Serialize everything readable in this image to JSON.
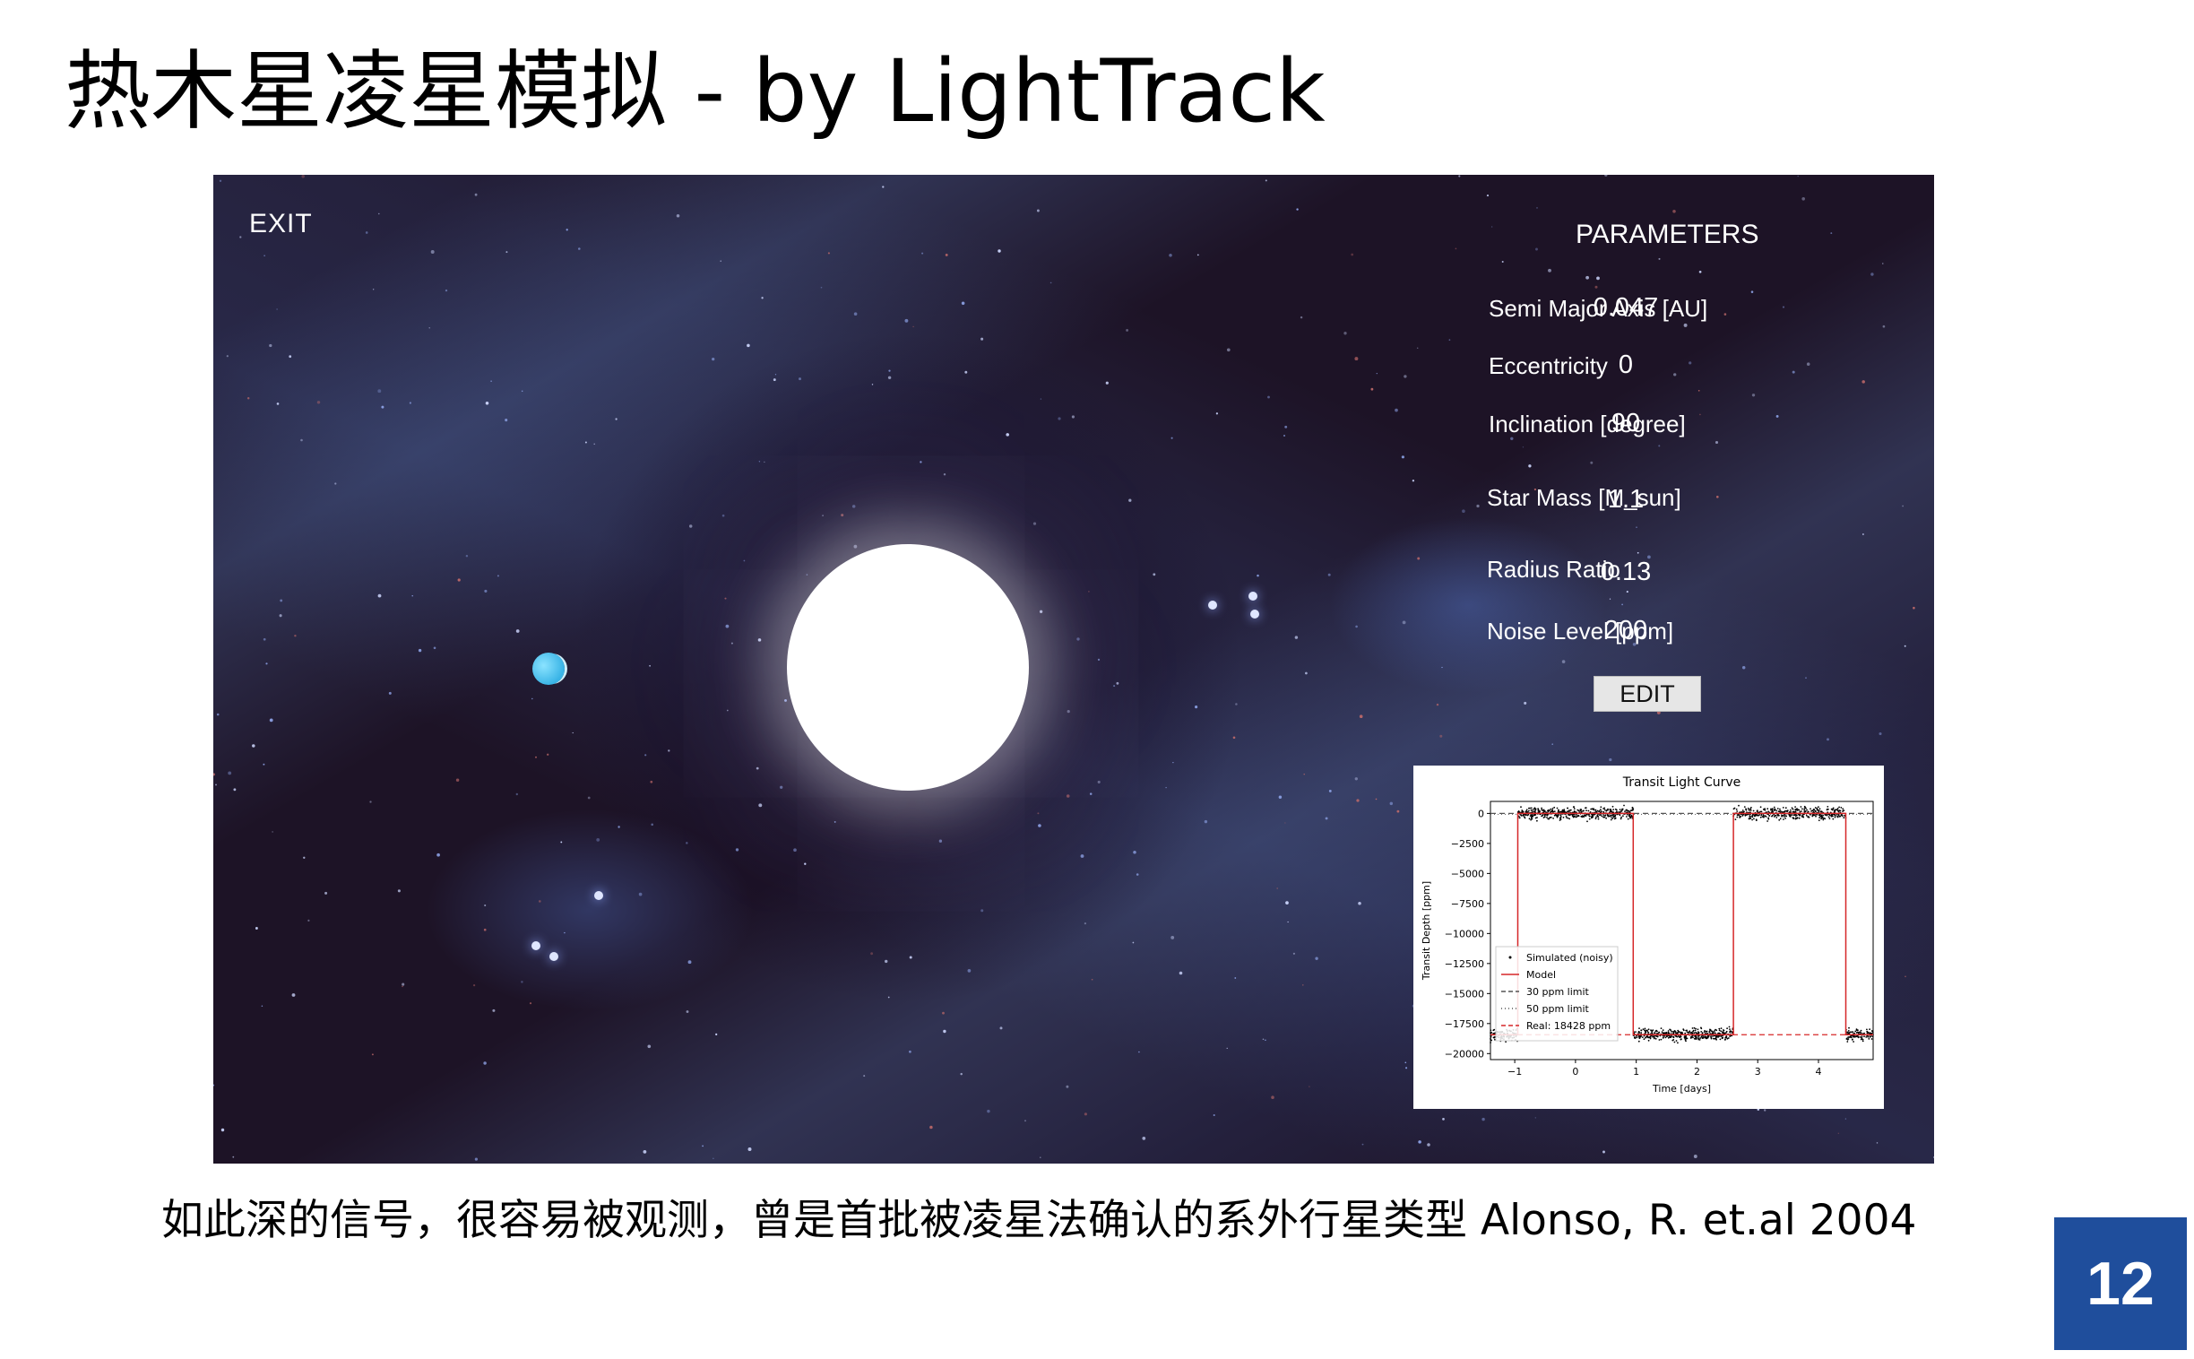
{
  "slide": {
    "title": "热木星凌星模拟 - by LightTrack",
    "caption": "如此深的信号，很容易被观测，曾是首批被凌星法确认的系外行星类型 Alonso, R. et.al 2004",
    "page_number": "12"
  },
  "app": {
    "exit_label": "EXIT",
    "parameters_title": "PARAMETERS",
    "parameters": [
      {
        "label": "Semi Major Axis [AU]",
        "value": "0.047"
      },
      {
        "label": "Eccentricity",
        "value": "0"
      },
      {
        "label": "Inclination [degree]",
        "value": "90"
      },
      {
        "label": "Star Mass [M_sun]",
        "value": "1.1"
      },
      {
        "label": "Radius Ratio",
        "value": "0.13"
      },
      {
        "label": "Noise Level [ppm]",
        "value": "200"
      }
    ],
    "edit_label": "EDIT"
  },
  "chart_data": {
    "type": "line",
    "title": "Transit Light Curve",
    "xlabel": "Time [days]",
    "ylabel": "Transit Depth [ppm]",
    "xlim": [
      -1.4,
      4.9
    ],
    "ylim": [
      -20500,
      1000
    ],
    "x_ticks": [
      -1,
      0,
      1,
      2,
      3,
      4
    ],
    "y_ticks": [
      0,
      -2500,
      -5000,
      -7500,
      -10000,
      -12500,
      -15000,
      -17500,
      -20000
    ],
    "x_tick_labels": [
      "−1",
      "0",
      "1",
      "2",
      "3",
      "4"
    ],
    "y_tick_labels": [
      "0",
      "−2500",
      "−5000",
      "−7500",
      "−10000",
      "−12500",
      "−15000",
      "−17500",
      "−20000"
    ],
    "legend_position": "bottom-left",
    "series": [
      {
        "name": "Simulated (noisy)",
        "style": "points",
        "color": "#000000"
      },
      {
        "name": "Model",
        "style": "line",
        "color": "#d62728",
        "x": [
          -1.4,
          -0.95,
          -0.95,
          -0.95,
          0.95,
          0.95,
          2.6,
          2.6,
          4.45,
          4.45,
          4.9
        ],
        "y": [
          -18428,
          -18428,
          0,
          0,
          0,
          -18428,
          -18428,
          0,
          0,
          -18428,
          -18428
        ]
      },
      {
        "name": "30 ppm limit",
        "style": "dashed",
        "color": "#555555",
        "y": 0
      },
      {
        "name": "50 ppm limit",
        "style": "dotted",
        "color": "#555555",
        "y": 0
      },
      {
        "name": "Real: 18428 ppm",
        "style": "dashed",
        "color": "#d62728",
        "y": -18428
      }
    ]
  }
}
